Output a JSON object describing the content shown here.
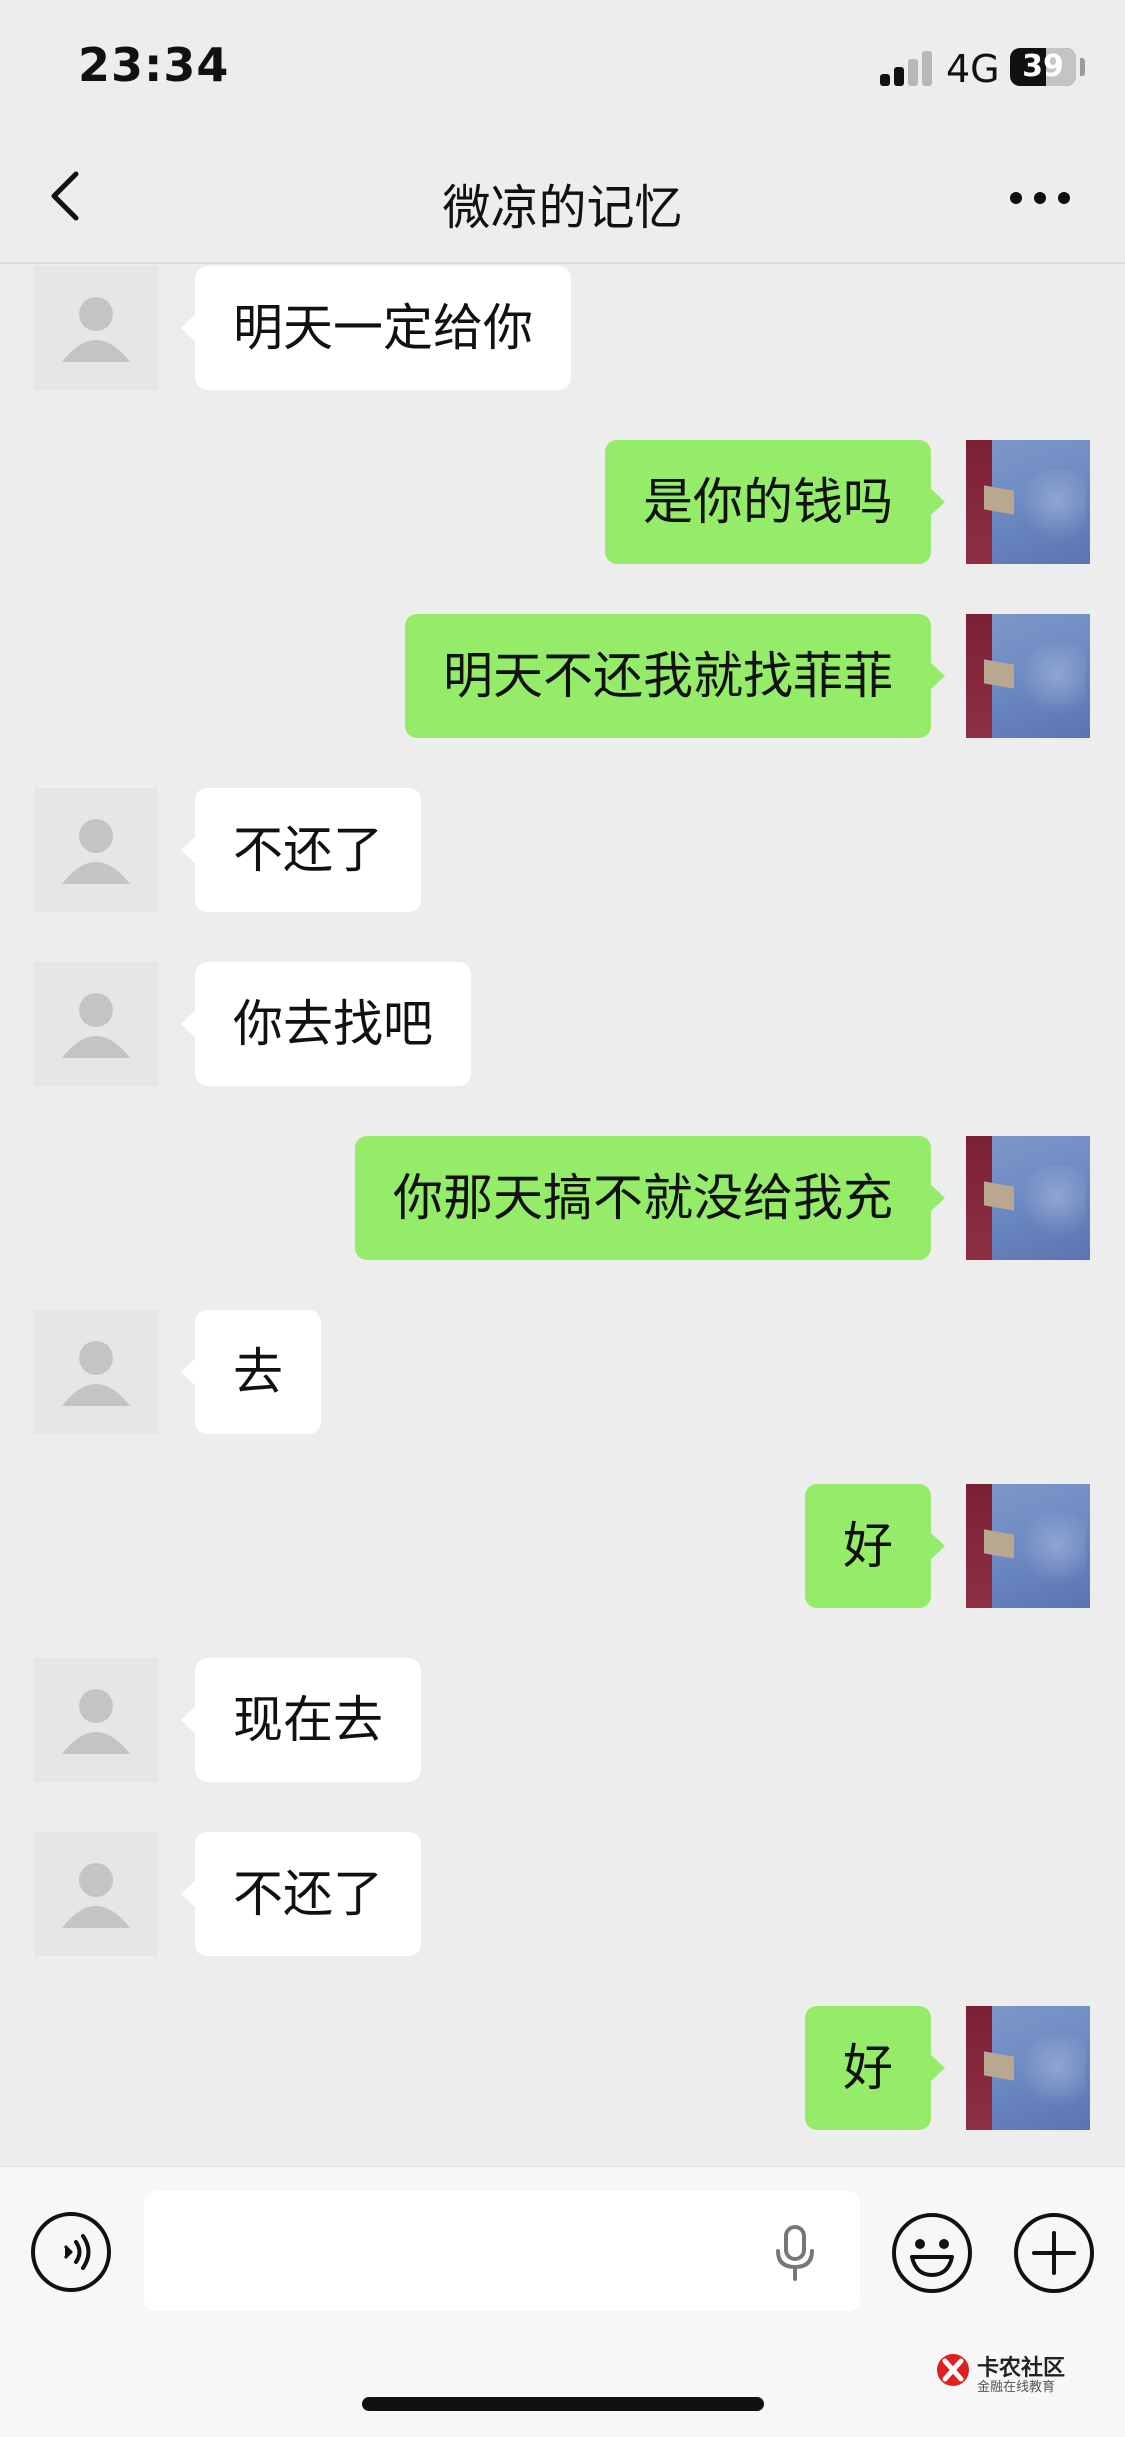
{
  "status_bar": {
    "time": "23:34",
    "network": "4G",
    "battery": "39"
  },
  "header": {
    "title": "微凉的记忆",
    "back_icon": "chevron-left-icon",
    "more_icon": "ellipsis-icon"
  },
  "messages": [
    {
      "side": "in",
      "text": "明天一定给你"
    },
    {
      "side": "out",
      "text": "是你的钱吗"
    },
    {
      "side": "out",
      "text": "明天不还我就找菲菲"
    },
    {
      "side": "in",
      "text": "不还了"
    },
    {
      "side": "in",
      "text": "你去找吧"
    },
    {
      "side": "out",
      "text": "你那天搞不就没给我充"
    },
    {
      "side": "in",
      "text": "去"
    },
    {
      "side": "out",
      "text": "好"
    },
    {
      "side": "in",
      "text": "现在去"
    },
    {
      "side": "in",
      "text": "不还了"
    },
    {
      "side": "out",
      "text": "好"
    }
  ],
  "input_bar": {
    "value": "",
    "voice_icon": "voice-icon",
    "mic_icon": "microphone-icon",
    "emoji_icon": "emoji-icon",
    "plus_icon": "plus-icon"
  },
  "watermark": {
    "title": "卡农社区",
    "subtitle": "金融在线教育"
  },
  "colors": {
    "background": "#ededed",
    "outgoing_bubble": "#95ec69",
    "incoming_bubble": "#ffffff"
  }
}
